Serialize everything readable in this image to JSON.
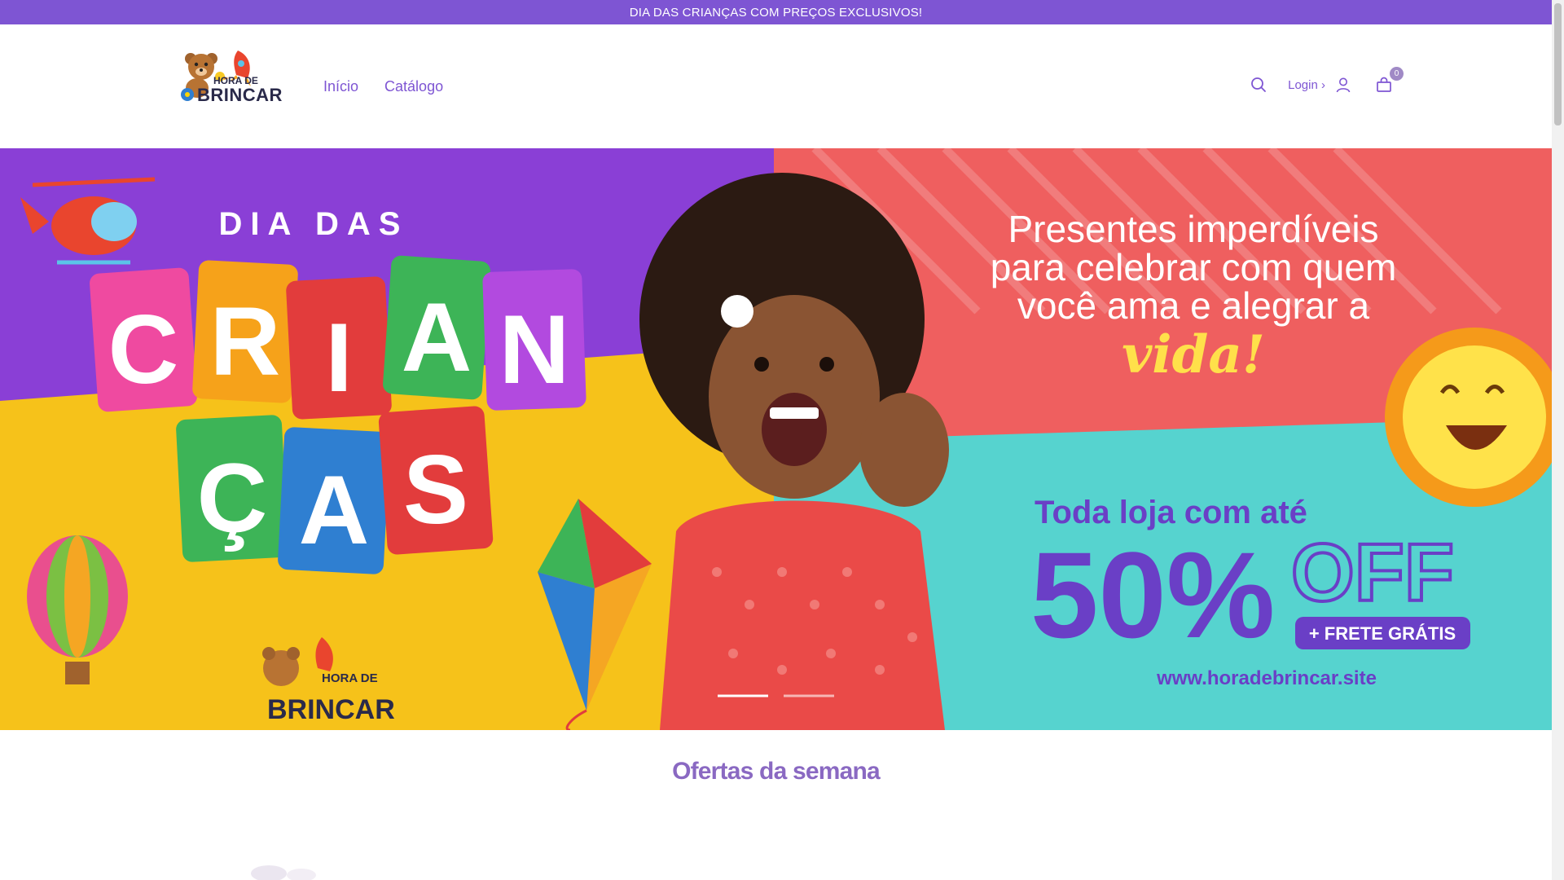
{
  "announcement": {
    "text": "DIA DAS CRIANÇAS COM PREÇOS EXCLUSIVOS!"
  },
  "brand": {
    "line1": "HORA DE",
    "line2": "BRINCAR"
  },
  "nav": [
    {
      "label": "Início"
    },
    {
      "label": "Catálogo"
    }
  ],
  "header_tools": {
    "search_icon": "search-icon",
    "login_label": "Login ›",
    "user_icon": "user-icon",
    "cart_icon": "bag-icon",
    "cart_count": "0"
  },
  "hero": {
    "left_line1": "DIA DAS",
    "left_letters_row1": [
      "C",
      "R",
      "I",
      "A",
      "N"
    ],
    "left_letters_row2": [
      "Ç",
      "A",
      "S"
    ],
    "right_line1": "Presentes imperdíveis",
    "right_line2": "para celebrar com quem",
    "right_line3": "você ama e alegrar a",
    "right_line4": "vida!",
    "promo_line1": "Toda loja com até",
    "promo_pct": "50%",
    "promo_off": "OFF",
    "promo_ship": "+ FRETE GRÁTIS",
    "url": "www.horadebrincar.site",
    "logo_line1": "HORA DE",
    "logo_line2": "BRINCAR",
    "slide_count": 2,
    "active_slide": 1
  },
  "section": {
    "title": "Ofertas da semana"
  },
  "colors": {
    "accent": "#7e55d3",
    "purple_bg": "#8a3fd6",
    "yellow_bg": "#f6c21a",
    "coral_bg": "#ef5f5f",
    "teal_bg": "#56d3cf"
  }
}
